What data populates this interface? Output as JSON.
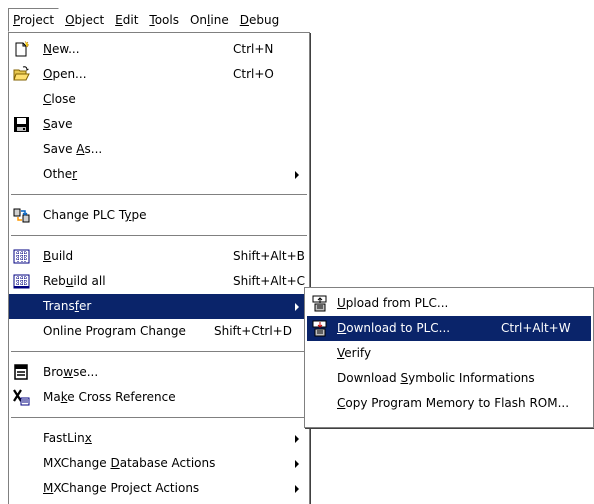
{
  "menubar": {
    "items": [
      {
        "pre": "",
        "acc": "P",
        "post": "roject"
      },
      {
        "pre": "",
        "acc": "O",
        "post": "bject"
      },
      {
        "pre": "",
        "acc": "E",
        "post": "dit"
      },
      {
        "pre": "",
        "acc": "T",
        "post": "ools"
      },
      {
        "pre": "On",
        "acc": "l",
        "post": "ine"
      },
      {
        "pre": "",
        "acc": "D",
        "post": "ebug"
      }
    ]
  },
  "project_menu": {
    "new": {
      "pre": "",
      "acc": "N",
      "post": "ew...",
      "shortcut": "Ctrl+N"
    },
    "open": {
      "pre": "",
      "acc": "O",
      "post": "pen...",
      "shortcut": "Ctrl+O"
    },
    "close": {
      "pre": "",
      "acc": "C",
      "post": "lose"
    },
    "save": {
      "pre": "",
      "acc": "S",
      "post": "ave"
    },
    "save_as": {
      "pre": "Save ",
      "acc": "A",
      "post": "s..."
    },
    "other": {
      "pre": "Othe",
      "acc": "r",
      "post": ""
    },
    "change_plc": {
      "pre": "Change PLC T",
      "acc": "y",
      "post": "pe"
    },
    "build": {
      "pre": "",
      "acc": "B",
      "post": "uild",
      "shortcut": "Shift+Alt+B"
    },
    "rebuild": {
      "pre": "Reb",
      "acc": "u",
      "post": "ild all",
      "shortcut": "Shift+Alt+C"
    },
    "transfer": {
      "pre": "Trans",
      "acc": "f",
      "post": "er"
    },
    "online_change": {
      "pre": "Online Program Change",
      "acc": "",
      "post": "",
      "shortcut": "Shift+Ctrl+D"
    },
    "browse": {
      "pre": "Bro",
      "acc": "w",
      "post": "se..."
    },
    "cross_ref": {
      "pre": "Ma",
      "acc": "k",
      "post": "e Cross Reference"
    },
    "fastlinx": {
      "pre": "FastLin",
      "acc": "x",
      "post": ""
    },
    "mx_db": {
      "pre": "MXChange ",
      "acc": "D",
      "post": "atabase Actions"
    },
    "mx_proj": {
      "pre": "",
      "acc": "M",
      "post": "XChange Project Actions"
    }
  },
  "transfer_menu": {
    "upload": {
      "pre": "",
      "acc": "U",
      "post": "pload from PLC..."
    },
    "download": {
      "pre": "",
      "acc": "D",
      "post": "ownload to PLC...",
      "shortcut": "Ctrl+Alt+W"
    },
    "verify": {
      "pre": "",
      "acc": "V",
      "post": "erify"
    },
    "symbolic": {
      "pre": "Download ",
      "acc": "S",
      "post": "ymbolic Informations"
    },
    "flash": {
      "pre": "",
      "acc": "C",
      "post": "opy Program Memory to Flash ROM..."
    }
  }
}
